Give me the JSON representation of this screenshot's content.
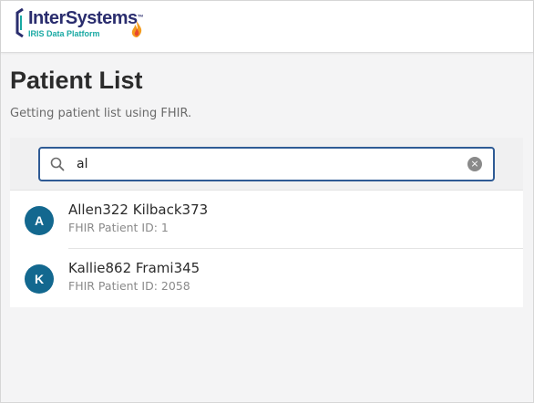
{
  "header": {
    "logo_name": "InterSystems",
    "logo_tm": "™",
    "logo_sub": "IRIS Data Platform"
  },
  "page": {
    "title": "Patient List",
    "subtitle": "Getting patient list using FHIR."
  },
  "search": {
    "value": "al",
    "clear_glyph": "×"
  },
  "patients": [
    {
      "initial": "A",
      "name": "Allen322 Kilback373",
      "id_text": "FHIR Patient ID: 1"
    },
    {
      "initial": "K",
      "name": "Kallie862 Frami345",
      "id_text": "FHIR Patient ID: 2058"
    }
  ],
  "icons": {
    "search": "search-icon",
    "clear": "clear-icon",
    "logo": "intersystems-logo"
  },
  "colors": {
    "brand_navy": "#2a2d6e",
    "brand_teal": "#19a9a3",
    "search_border": "#2f5b95",
    "avatar_bg": "#13688f"
  }
}
